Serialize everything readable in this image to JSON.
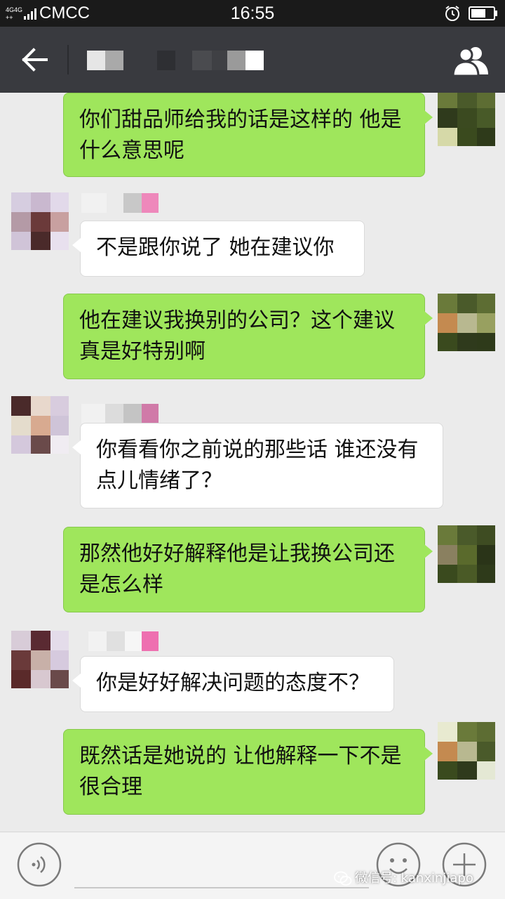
{
  "status_bar": {
    "network": "4G 4G",
    "carrier": "CMCC",
    "time": "16:55",
    "icons": [
      "signal-icon",
      "alarm-icon",
      "battery-icon"
    ]
  },
  "header": {
    "back_icon": "arrow-left-icon",
    "group_icon": "group-members-icon",
    "title_pixelated": true
  },
  "messages": [
    {
      "side": "sent",
      "text": "你们甜品师给我的话是这样的 他是\n什么意思呢"
    },
    {
      "side": "recv",
      "text": "不是跟你说了 她在建议你"
    },
    {
      "side": "sent",
      "text": "他在建议我换别的公司？这个建议\n真是好特别啊"
    },
    {
      "side": "recv",
      "text": "你看看你之前说的那些话 谁还没有\n点儿情绪了？"
    },
    {
      "side": "sent",
      "text": "那然他好好解释他是让我换公司还\n是怎么样"
    },
    {
      "side": "recv",
      "text": "你是好好解决问题的态度不？"
    },
    {
      "side": "sent",
      "text": "既然话是她说的 让他解释一下不是\n很合理"
    }
  ],
  "input_bar": {
    "voice_icon": "voice-icon",
    "emoji_icon": "emoji-icon",
    "plus_icon": "plus-icon"
  },
  "watermark": {
    "icon": "wechat-icon",
    "text": "微信号: kanxinjiapo"
  },
  "colors": {
    "header_bg": "#393a3f",
    "status_bg": "#1a1a1a",
    "chat_bg": "#ebebeb",
    "sent_bubble": "#9fe65c",
    "recv_bubble": "#ffffff"
  }
}
